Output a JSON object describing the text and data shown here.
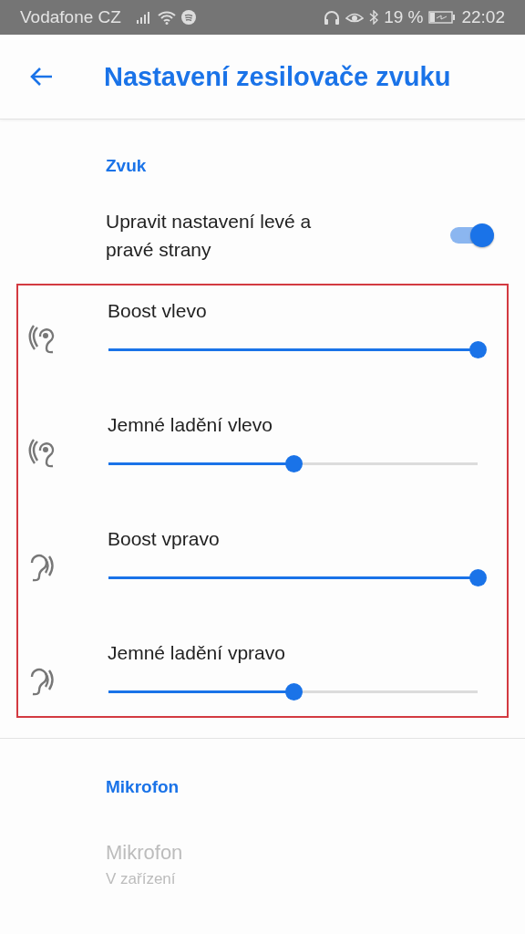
{
  "status_bar": {
    "carrier": "Vodafone CZ",
    "battery": "19 %",
    "time": "22:02"
  },
  "app_bar": {
    "title": "Nastavení zesilovače zvuku"
  },
  "sections": [
    {
      "header": "Zvuk",
      "toggle": {
        "label": "Upravit nastavení levé a pravé strany",
        "on": true
      },
      "sliders": [
        {
          "label": "Boost vlevo",
          "kind": "left",
          "level": 1
        },
        {
          "label": "Jemné ladění vlevo",
          "kind": "left",
          "level": 0.5
        },
        {
          "label": "Boost vpravo",
          "kind": "right",
          "level": 1
        },
        {
          "label": "Jemné ladění vpravo",
          "kind": "right",
          "level": 0.5
        }
      ]
    },
    {
      "header": "Mikrofon",
      "item": {
        "title": "Mikrofon",
        "subtitle": "V zařízení",
        "disabled": true
      }
    }
  ]
}
